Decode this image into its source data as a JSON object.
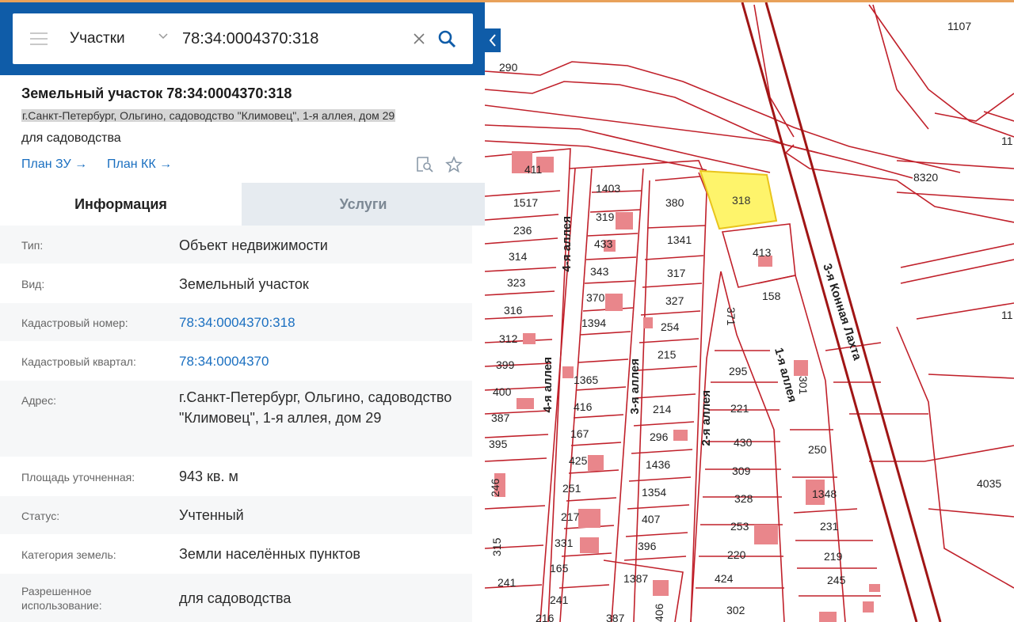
{
  "search": {
    "type_label": "Участки",
    "query": "78:34:0004370:318"
  },
  "object": {
    "title": "Земельный участок 78:34:0004370:318",
    "address": "г.Санкт-Петербург, Ольгино, садоводство \"Климовец\", 1-я аллея, дом 29",
    "purpose": "для садоводства",
    "links": [
      "План ЗУ →",
      "План КК →"
    ]
  },
  "tabs": [
    "Информация",
    "Услуги"
  ],
  "info_rows": [
    {
      "label": "Тип:",
      "value": "Объект недвижимости"
    },
    {
      "label": "Вид:",
      "value": "Земельный участок"
    },
    {
      "label": "Кадастровый номер:",
      "value": "78:34:0004370:318"
    },
    {
      "label": "Кадастровый квартал:",
      "value": "78:34:0004370"
    },
    {
      "label": "Адрес:",
      "value": "г.Санкт-Петербург, Ольгино, садоводство \"Климовец\", 1-я аллея, дом 29"
    },
    {
      "label": "Площадь уточненная:",
      "value": "943 кв. м"
    },
    {
      "label": "Статус:",
      "value": "Учтенный"
    },
    {
      "label": "Категория земель:",
      "value": "Земли населённых пунктов"
    },
    {
      "label": "Разрешенное использование:",
      "value": "для садоводства"
    }
  ],
  "map": {
    "streets": [
      "4-я аллея",
      "4-я аллея",
      "3-я аллея",
      "2-я аллея",
      "1-я аллея",
      "3-я Конная Лахта"
    ],
    "parcels": [
      "290",
      "1107",
      "411",
      "1403",
      "1517",
      "319",
      "236",
      "433",
      "314",
      "343",
      "323",
      "370",
      "316",
      "1394",
      "312",
      "399",
      "1365",
      "400",
      "416",
      "387",
      "167",
      "395",
      "425",
      "246",
      "251",
      "217",
      "315",
      "331",
      "165",
      "241",
      "241",
      "216",
      "380",
      "1341",
      "317",
      "327",
      "254",
      "215",
      "214",
      "296",
      "1436",
      "1354",
      "407",
      "396",
      "1387",
      "387",
      "406",
      "318",
      "413",
      "158",
      "371",
      "295",
      "221",
      "430",
      "309",
      "328",
      "253",
      "220",
      "424",
      "302",
      "301",
      "250",
      "1348",
      "231",
      "219",
      "245",
      "8320",
      "4035",
      "11"
    ],
    "colors": {
      "parcel_line": "#c0202a",
      "selected_fill": "#fef46b",
      "building": "#e9868b",
      "road": "#a01515"
    }
  }
}
